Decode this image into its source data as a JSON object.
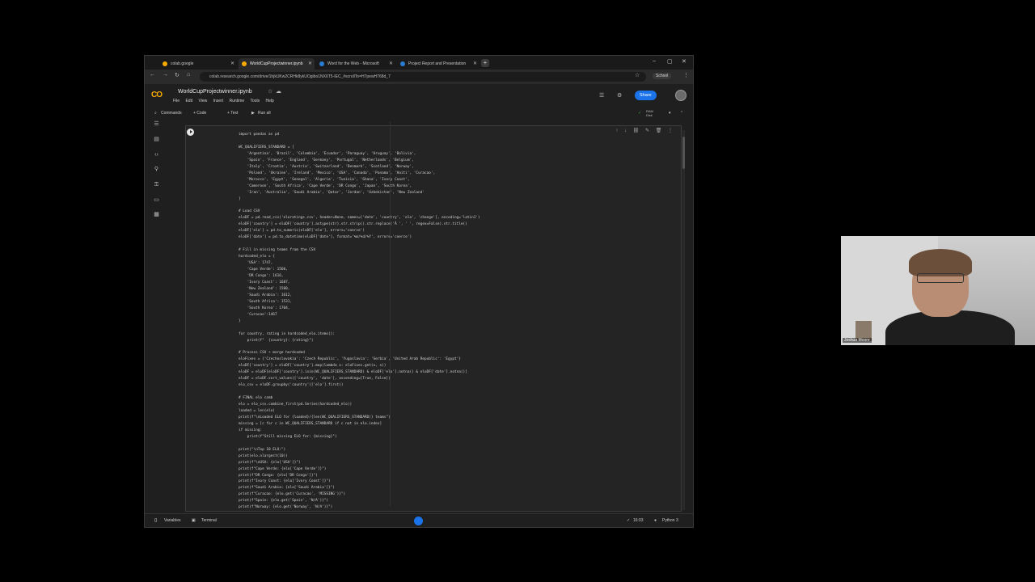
{
  "browser": {
    "tabs": [
      {
        "label": "colab.google",
        "fav": "#f9ab00"
      },
      {
        "label": "WorldCupProjectwinner.ipynb",
        "fav": "#f9ab00"
      },
      {
        "label": "Word for the Web - Microsoft",
        "fav": "#2b7cd3"
      },
      {
        "label": "Project Report and Presentation",
        "fav": "#2b7cd3"
      }
    ],
    "new_tab": "+",
    "url": "colab.research.google.com/drive/1hjkUKw2CRHk8ykUOgibo1NX6T5-IEC_#scrollTo=H7pewH768d_7",
    "profile": "School"
  },
  "colab": {
    "logo": "CO",
    "title": "WorldCupProjectwinner.ipynb",
    "menu": [
      "File",
      "Edit",
      "View",
      "Insert",
      "Runtime",
      "Tools",
      "Help"
    ],
    "share": "Share",
    "toolbar": {
      "commands": "Commands",
      "add_code": "+ Code",
      "add_text": "+ Text",
      "run_all": "Run all",
      "ram": "RAM",
      "disk": "Disk"
    },
    "code": "import pandas as pd\n\nWC_QUALIFIERS_STANDARD = [\n    'Argentina', 'Brazil', 'Colombia', 'Ecuador', 'Paraguay', 'Uruguay', 'Bolivia',\n    'Spain', 'France', 'England', 'Germany', 'Portugal', 'Netherlands', 'Belgium',\n    'Italy', 'Croatia', 'Austria', 'Switzerland', 'Denmark', 'Scotland', 'Norway',\n    'Poland', 'Ukraine', 'Ireland', 'Mexico', 'USA', 'Canada', 'Panama', 'Haiti', 'Curacao',\n    'Morocco', 'Egypt', 'Senegal', 'Algeria', 'Tunisia', 'Ghana', 'Ivory Coast',\n    'Cameroon', 'South Africa', 'Cape Verde', 'DR Congo', 'Japan', 'South Korea',\n    'Iran', 'Australia', 'Saudi Arabia', 'Qatar', 'Jordan', 'Uzbekistan', 'New Zealand'\n]\n\n# Load CSV\neloDF = pd.read_csv('eloratings.csv', header=None, names=['date', 'country', 'elo', 'change'], encoding='latin1')\neloDF['country'] = eloDF['country'].astype(str).str.strip().str.replace('Â ', ' ', regex=False).str.title()\neloDF['elo'] = pd.to_numeric(eloDF['elo'], errors='coerce')\neloDF['date'] = pd.to_datetime(eloDF['date'], format='%m/%d/%Y', errors='coerce')\n\n# Fill in missing teams from the CSV\nhardcoded_elo = {\n    'USA': 1747,\n    'Cape Verde': 1560,\n    'DR Congo': 1616,\n    'Ivory Coast': 1687,\n    'New Zealand': 1500,\n    'Saudi Arabia': 1612,\n    'South Africa': 1531,\n    'South Korea': 1704,\n    'Curacao':1467\n}\n\nfor country, rating in hardcoded_elo.items():\n    print(f\"  {country}: {rating}\")\n\n# Process CSV + merge hardcoded\neloFixes = {'Czechoslovakia': 'Czech Republic', 'Yugoslavia': 'Serbia', 'United Arab Republic': 'Egypt'}\neloDF['country'] = eloDF['country'].map(lambda x: eloFixes.get(x, x))\neloDF = eloDF[eloDF['country'].isin(WC_QUALIFIERS_STANDARD) & eloDF['elo'].notna() & eloDF['date'].notna()]\neloDF = eloDF.sort_values(['country', 'date'], ascending=[True, False])\nelo_csv = eloDF.groupby('country')['elo'].first()\n\n# FINAL elo comb\nelo = elo_csv.combine_first(pd.Series(hardcoded_elo))\nloaded = len(elo)\nprint(f\"\\nLoaded ELO for {loaded}/{len(WC_QUALIFIERS_STANDARD)} teams\")\nmissing = [c for c in WC_QUALIFIERS_STANDARD if c not in elo.index]\nif missing:\n    print(f\"Still missing ELO for: {missing}\")\n\nprint(\"\\nTop 10 ELO:\")\nprint(elo.nlargest(10))\nprint(f\"\\nUSA: {elo['USA']}\")\nprint(f\"Cape Verde: {elo['Cape Verde']}\")\nprint(f\"DR Congo: {elo['DR Congo']}\")\nprint(f\"Ivory Coast: {elo['Ivory Coast']}\")\nprint(f\"Saudi Arabia: {elo['Saudi Arabia']}\")\nprint(f\"Curacao: {elo.get('Curacao', 'MISSING')}\")\nprint(f\"Spain: {elo.get('Spain', 'N/A')}\")\nprint(f\"Norway: {elo.get('Norway', 'N/A')}\")",
    "status": {
      "variables": "Variables",
      "terminal": "Terminal",
      "time": "16:03",
      "runtime": "Python 3"
    }
  },
  "webcam": {
    "name": "Joshua Moore"
  },
  "colors": {
    "accent": "#1a73e8",
    "colab_orange": "#f9ab00",
    "background": "#1f1f1f"
  }
}
